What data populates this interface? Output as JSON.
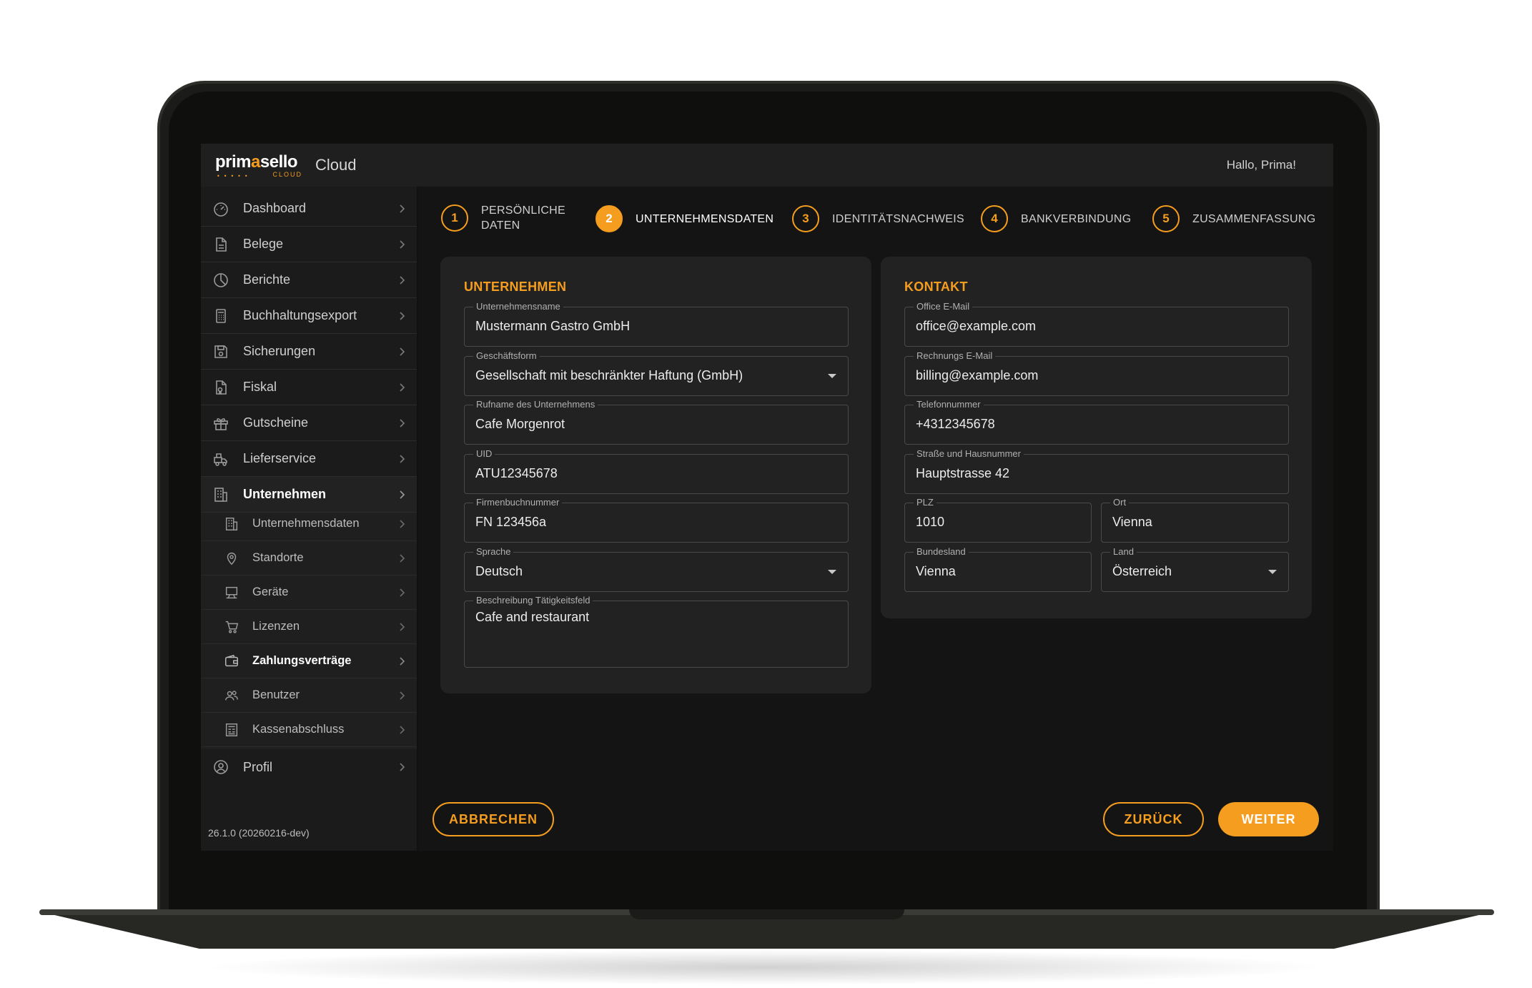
{
  "app": {
    "logo_text_left": "prim",
    "logo_text_mark": "a",
    "logo_text_right": "sello",
    "logo_sub": "CLOUD",
    "title": "Cloud",
    "greeting": "Hallo, Prima!"
  },
  "sidebar": {
    "items": [
      {
        "label": "Dashboard",
        "icon": "gauge-icon"
      },
      {
        "label": "Belege",
        "icon": "document-icon"
      },
      {
        "label": "Berichte",
        "icon": "pie-chart-icon"
      },
      {
        "label": "Buchhaltungsexport",
        "icon": "calculator-icon"
      },
      {
        "label": "Sicherungen",
        "icon": "floppy-disk-icon"
      },
      {
        "label": "Fiskal",
        "icon": "file-certificate-icon"
      },
      {
        "label": "Gutscheine",
        "icon": "gift-icon"
      },
      {
        "label": "Lieferservice",
        "icon": "delivery-icon"
      },
      {
        "label": "Unternehmen",
        "icon": "building-icon"
      }
    ],
    "sub_items": [
      {
        "label": "Unternehmensdaten",
        "icon": "building-icon"
      },
      {
        "label": "Standorte",
        "icon": "map-pin-icon"
      },
      {
        "label": "Geräte",
        "icon": "pos-terminal-icon"
      },
      {
        "label": "Lizenzen",
        "icon": "cart-icon"
      },
      {
        "label": "Zahlungsverträge",
        "icon": "wallet-icon"
      },
      {
        "label": "Benutzer",
        "icon": "users-icon"
      },
      {
        "label": "Kassenabschluss",
        "icon": "register-report-icon"
      }
    ],
    "profile": {
      "label": "Profil",
      "icon": "user-circle-icon"
    },
    "version": "26.1.0 (20260216-dev)"
  },
  "stepper": {
    "steps": [
      {
        "num": "1",
        "label_line1": "PERSÖNLICHE",
        "label_line2": "DATEN"
      },
      {
        "num": "2",
        "label": "UNTERNEHMENSDATEN"
      },
      {
        "num": "3",
        "label": "IDENTITÄTSNACHWEIS"
      },
      {
        "num": "4",
        "label": "BANKVERBINDUNG"
      },
      {
        "num": "5",
        "label": "ZUSAMMENFASSUNG"
      }
    ],
    "active": 2
  },
  "company": {
    "title": "UNTERNEHMEN",
    "name_label": "Unternehmensname",
    "name_value": "Mustermann Gastro GmbH",
    "form_label": "Geschäftsform",
    "form_value": "Gesellschaft mit beschränkter Haftung (GmbH)",
    "callname_label": "Rufname des Unternehmens",
    "callname_value": "Cafe Morgenrot",
    "uid_label": "UID",
    "uid_value": "ATU12345678",
    "fn_label": "Firmenbuchnummer",
    "fn_value": "FN 123456a",
    "lang_label": "Sprache",
    "lang_value": "Deutsch",
    "desc_label": "Beschreibung Tätigkeitsfeld",
    "desc_value": "Cafe and restaurant"
  },
  "contact": {
    "title": "KONTAKT",
    "office_label": "Office E-Mail",
    "office_value": "office@example.com",
    "billing_label": "Rechnungs E-Mail",
    "billing_value": "billing@example.com",
    "phone_label": "Telefonnummer",
    "phone_value": "+4312345678",
    "street_label": "Straße und Hausnummer",
    "street_value": "Hauptstrasse 42",
    "zip_label": "PLZ",
    "zip_value": "1010",
    "city_label": "Ort",
    "city_value": "Vienna",
    "state_label": "Bundesland",
    "state_value": "Vienna",
    "country_label": "Land",
    "country_value": "Österreich"
  },
  "actions": {
    "cancel": "ABBRECHEN",
    "back": "ZURÜCK",
    "next": "WEITER"
  },
  "colors": {
    "accent": "#f59d1e",
    "background": "#141414",
    "card": "#222222"
  }
}
